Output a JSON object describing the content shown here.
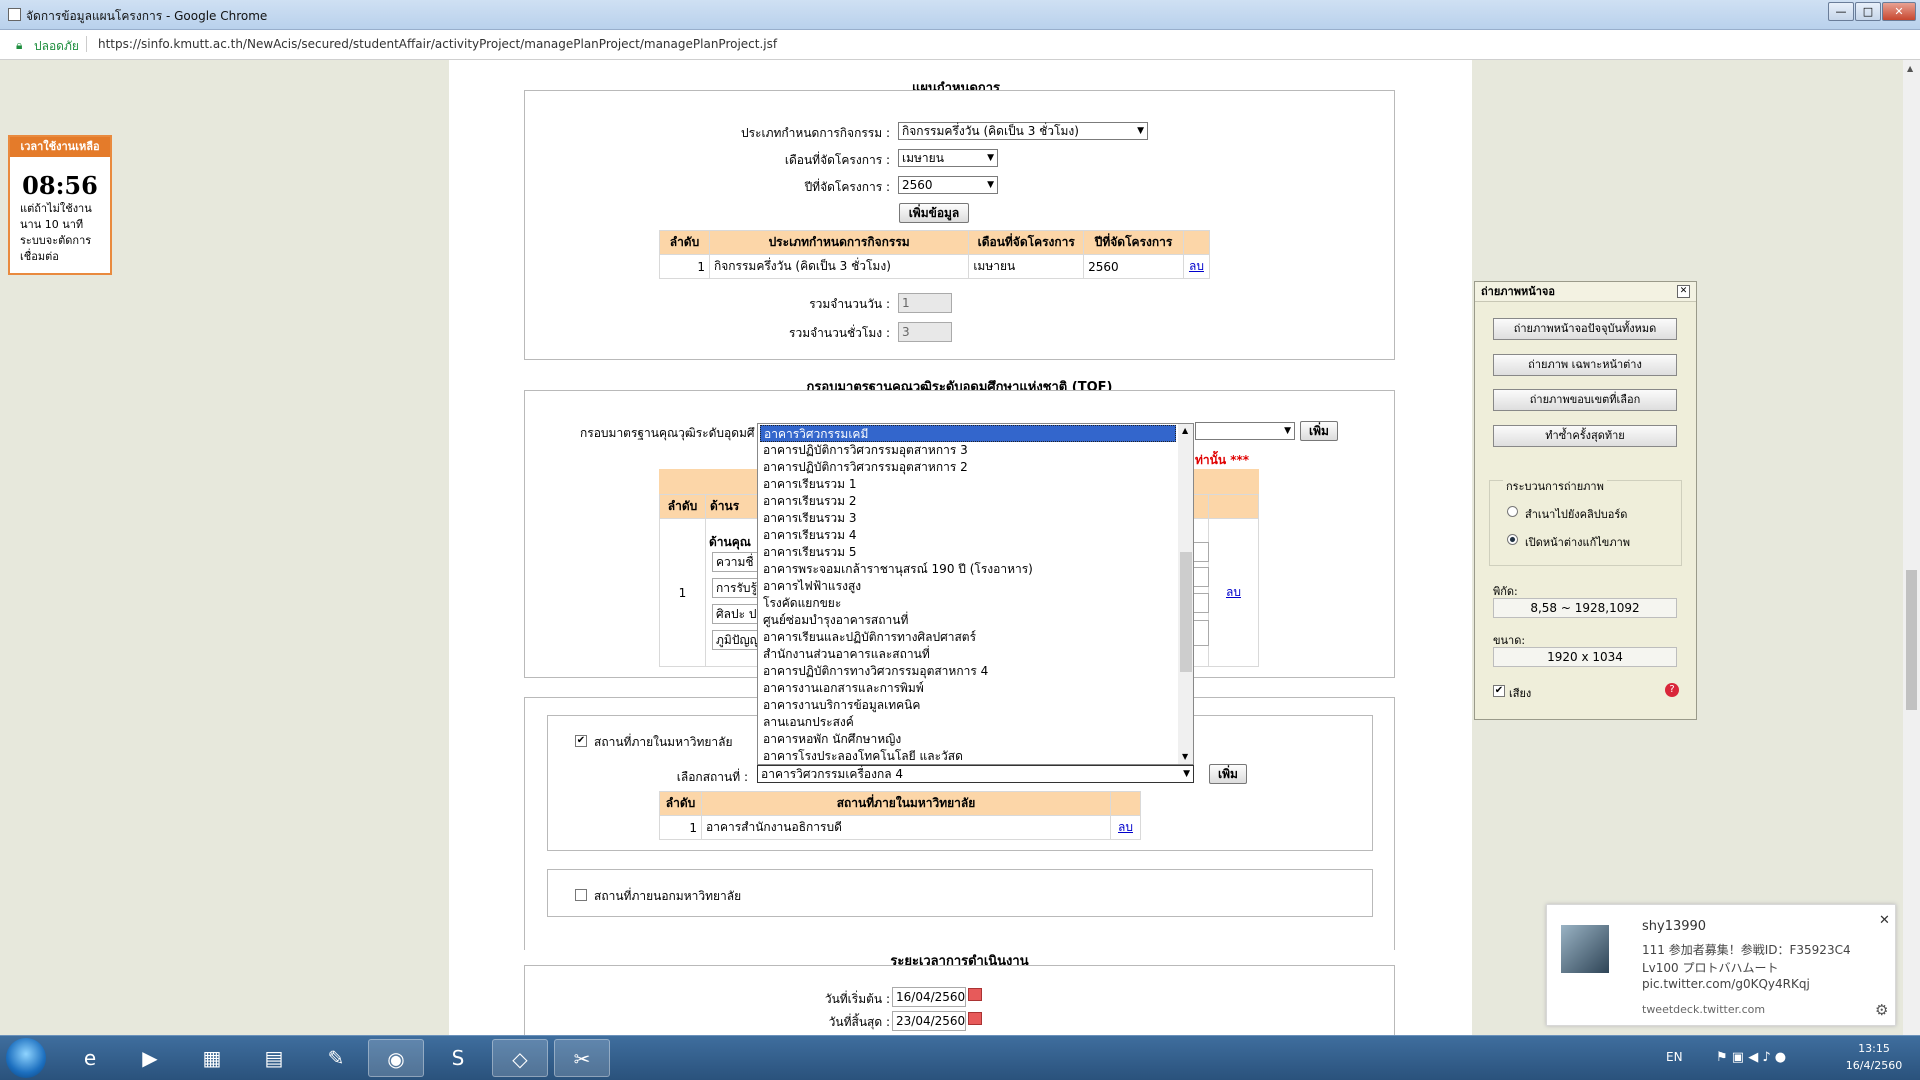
{
  "window": {
    "title": "จัดการข้อมูลแผนโครงการ - Google Chrome",
    "btn_min": "—",
    "btn_max": "□",
    "btn_close": "✕"
  },
  "address": {
    "secure": "ปลอดภัย",
    "url": "https://sinfo.kmutt.ac.th/NewAcis/secured/studentAffair/activityProject/managePlanProject/managePlanProject.jsf"
  },
  "timer": {
    "header": "เวลาใช้งานเหลือ",
    "time": "08:56",
    "message": "แต่ถ้าไม่ใช้งาน นาน 10 นาที ระบบจะตัดการเชื่อมต่อ"
  },
  "plan": {
    "title": "แผนกำหนดการ",
    "type_label": "ประเภทกำหนดการกิจกรรม :",
    "type_value": "กิจกรรมครึ่งวัน (คิดเป็น 3 ชั่วโมง)",
    "month_label": "เดือนที่จัดโครงการ :",
    "month_value": "เมษายน",
    "year_label": "ปีที่จัดโครงการ :",
    "year_value": "2560",
    "add_button": "เพิ่มข้อมูล",
    "table": {
      "headers": [
        "ลำดับ",
        "ประเภทกำหนดการกิจกรรม",
        "เดือนที่จัดโครงการ",
        "ปีที่จัดโครงการ",
        ""
      ],
      "rows": [
        [
          "1",
          "กิจกรรมครึ่งวัน (คิดเป็น 3 ชั่วโมง)",
          "เมษายน",
          "2560",
          "ลบ"
        ]
      ]
    },
    "days_label": "รวมจำนวนวัน :",
    "days_value": "1",
    "hours_label": "รวมจำนวนชั่วโมง :",
    "hours_value": "3"
  },
  "tqf": {
    "title": "กรอบมาตรฐานคุณวุฒิระดับอุดมศึกษาแห่งชาติ (TQF)",
    "label": "กรอบมาตรฐานคุณวุฒิระดับอุดมศึ",
    "add_button": "เพิ่ม",
    "warn": "ท่านั้น ***",
    "th1": "ลำดับ",
    "th2": "ด้านร",
    "row_no": "1",
    "group": "ด้านคุณ",
    "items": [
      "ความชื่",
      "การรับรู้",
      "ศิลปะ ป",
      "ภูมิปัญญ"
    ],
    "delete": "ลบ"
  },
  "dropdown": {
    "options": [
      "อาคารวิศวกรรมเคมี",
      "อาคารปฏิบัติการวิศวกรรมอุตสาหการ 3",
      "อาคารปฏิบัติการวิศวกรรมอุตสาหการ 2",
      "อาคารเรียนรวม 1",
      "อาคารเรียนรวม 2",
      "อาคารเรียนรวม 3",
      "อาคารเรียนรวม 4",
      "อาคารเรียนรวม 5",
      "อาคารพระจอมเกล้าราชานุสรณ์ 190 ปี (โรงอาหาร)",
      "อาคารไฟฟ้าแรงสูง",
      "โรงคัดแยกขยะ",
      "ศูนย์ซ่อมบำรุงอาคารสถานที่",
      "อาคารเรียนและปฏิบัติการทางศิลปศาสตร์",
      "สำนักงานส่วนอาคารและสถานที่",
      "อาคารปฏิบัติการทางวิศวกรรมอุตสาหการ 4",
      "อาคารงานเอกสารและการพิมพ์",
      "อาคารงานบริการข้อมูลเทคนิค",
      "ลานเอนกประสงค์",
      "อาคารหอพัก นักศึกษาหญิง",
      "อาคารโรงประลองโทคโนโลยี และวัสด"
    ]
  },
  "venue": {
    "inside_label": "สถานที่ภายในมหาวิทยาลัย",
    "select_label": "เลือกสถานที่ :",
    "select_value": "อาคารวิศวกรรมเครื่องกล 4",
    "add_button": "เพิ่ม",
    "table": {
      "headers": [
        "ลำดับ",
        "สถานที่ภายในมหาวิทยาลัย",
        ""
      ],
      "rows": [
        [
          "1",
          "อาคารสำนักงานอธิการบดี",
          "ลบ"
        ]
      ]
    },
    "outside_label": "สถานที่ภายนอกมหาวิทยาลัย"
  },
  "period": {
    "title": "ระยะเวลาการดำเนินงาน",
    "start_label": "วันที่เริ่มต้น :",
    "start_value": "16/04/2560",
    "end_label": "วันที่สิ้นสุด :",
    "end_value": "23/04/2560"
  },
  "capture": {
    "title": "ถ่ายภาพหน้าจอ",
    "btn1": "ถ่ายภาพหน้าจอปัจจุบันทั้งหมด",
    "btn2": "ถ่ายภาพ เฉพาะหน้าต่าง",
    "btn3": "ถ่ายภาพขอบเขตที่เลือก",
    "btn4": "ทำซ้ำครั้งสุดท้าย",
    "group": "กระบวนการถ่ายภาพ",
    "opt1": "สำเนาไปยังคลิปบอร์ด",
    "opt2": "เปิดหน้าต่างแก้ไขภาพ",
    "coord_label": "พิกัด:",
    "coord_value": "8,58 ~ 1928,1092",
    "size_label": "ขนาด:",
    "size_value": "1920 x 1034",
    "sound": "เสียง"
  },
  "notification": {
    "user": "shy13990",
    "line1": "111 参加者募集！参戦ID：F35923C4",
    "line2": "Lv100 プロトバハムート",
    "line3": "pic.twitter.com/g0KQy4RKqj",
    "source": "tweetdeck.twitter.com"
  },
  "taskbar": {
    "lang": "EN",
    "time": "13:15",
    "date": "16/4/2560"
  }
}
